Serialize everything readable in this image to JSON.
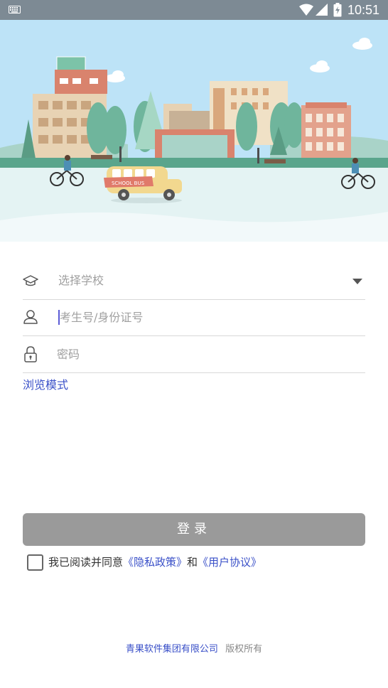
{
  "status_bar": {
    "time": "10:51",
    "icons": [
      "keyboard-icon",
      "wifi-icon",
      "signal-icon",
      "battery-charging-icon"
    ]
  },
  "banner": {
    "bus_label": "SCHOOL BUS",
    "colors": {
      "sky": "#bde3f7",
      "ground": "#e4f3f3",
      "wave": "#f2f9fa"
    }
  },
  "form": {
    "school": {
      "placeholder": "选择学校",
      "icon": "graduation-cap-icon"
    },
    "account": {
      "placeholder": "考生号/身份证号",
      "value": "",
      "icon": "user-icon"
    },
    "password": {
      "placeholder": "密码",
      "value": "",
      "icon": "lock-icon"
    },
    "browse_mode": "浏览模式",
    "login_label": "登录",
    "agreement": {
      "prefix": "我已阅读并同意",
      "privacy_link": "《隐私政策》",
      "and": "和",
      "user_link": "《用户协议》",
      "checked": false
    }
  },
  "footer": {
    "company": "青果软件集团有限公司",
    "rights": "版权所有"
  },
  "colors": {
    "accent": "#3a50c8",
    "button_disabled": "#9a9a9a",
    "status_bar": "#7d8a94"
  }
}
